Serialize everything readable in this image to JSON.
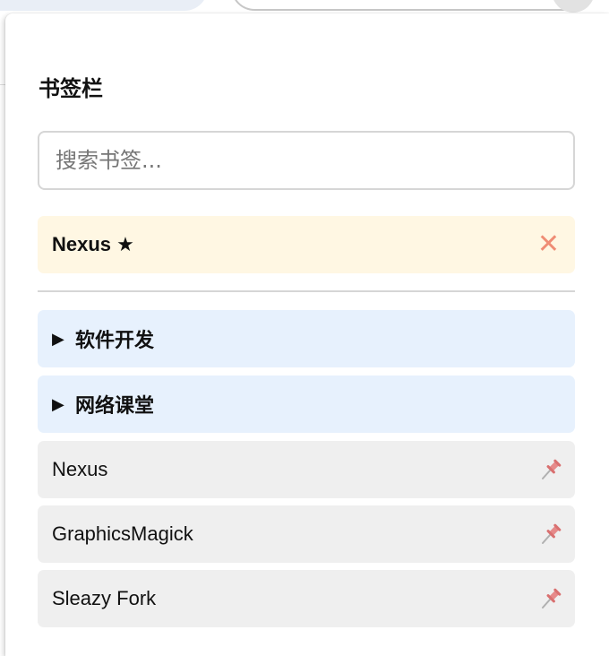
{
  "panel": {
    "title": "书签栏"
  },
  "search": {
    "placeholder": "搜索书签..."
  },
  "pinned": {
    "label": "Nexus ★",
    "close_icon": "close-icon",
    "close_glyph": "✕",
    "accent": "#ef8d75",
    "background": "#fff7e3"
  },
  "folders": [
    {
      "label": "软件开发",
      "caret": "▶",
      "icon": "caret-right-icon"
    },
    {
      "label": "网络课堂",
      "caret": "▶",
      "icon": "caret-right-icon"
    }
  ],
  "bookmarks": [
    {
      "label": "Nexus",
      "icon": "pin-icon"
    },
    {
      "label": "GraphicsMagick",
      "icon": "pin-icon"
    },
    {
      "label": "Sleazy Fork",
      "icon": "pin-icon"
    }
  ],
  "colors": {
    "folder_bg": "#e7f1fd",
    "bookmark_bg": "#efefef",
    "pin": "#e68a8a"
  }
}
